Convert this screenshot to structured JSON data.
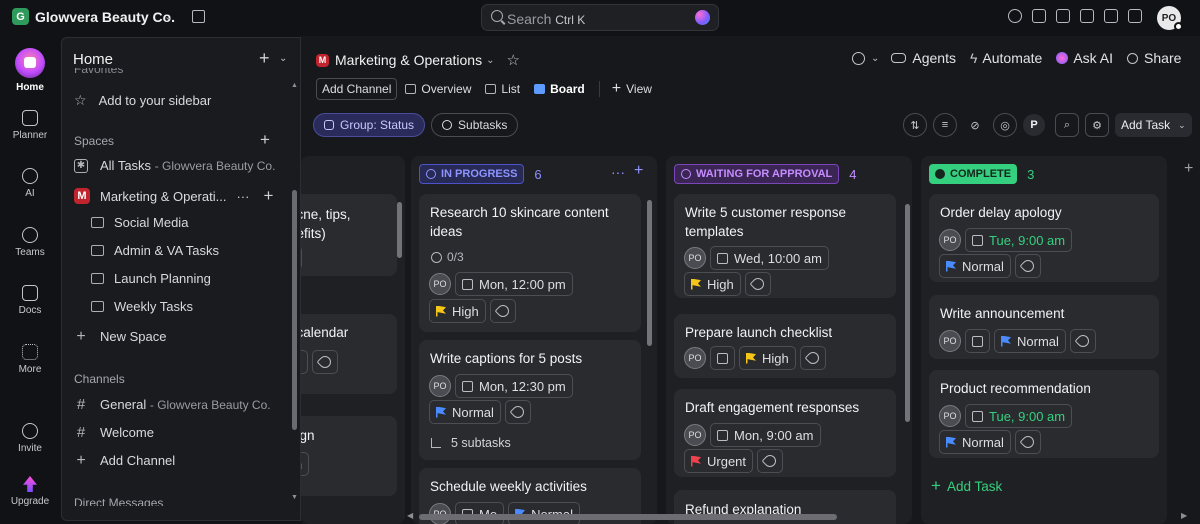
{
  "workspace": {
    "badge": "G",
    "name": "Glowvera Beauty Co."
  },
  "search": {
    "placeholder": "Search",
    "shortcut": "Ctrl K"
  },
  "user": {
    "initials": "PO"
  },
  "rail": [
    {
      "label": "Home",
      "icon": "home-icon"
    },
    {
      "label": "Planner",
      "icon": "planner-icon"
    },
    {
      "label": "AI",
      "icon": "ai-icon"
    },
    {
      "label": "Teams",
      "icon": "teams-icon"
    },
    {
      "label": "Docs",
      "icon": "docs-icon"
    },
    {
      "label": "More",
      "icon": "more-grid-icon"
    },
    {
      "label": "Invite",
      "icon": "invite-icon"
    },
    {
      "label": "Upgrade",
      "icon": "upgrade-icon"
    }
  ],
  "sidebar": {
    "title": "Home",
    "favorites_cut": "Favorites",
    "add_to_sidebar": "Add to your sidebar",
    "spaces_header": "Spaces",
    "all_tasks": "All Tasks",
    "all_tasks_sub": "- Glowvera Beauty Co.",
    "space_badge": "M",
    "space_name": "Marketing & Operati...",
    "folders": [
      "Social Media",
      "Admin & VA Tasks",
      "Launch Planning",
      "Weekly Tasks"
    ],
    "new_space": "New Space",
    "channels_header": "Channels",
    "channel_general": "General",
    "channel_general_sub": "- Glowvera Beauty Co.",
    "channel_welcome": "Welcome",
    "add_channel": "Add Channel",
    "dm_header": "Direct Messages"
  },
  "main": {
    "badge": "M",
    "title": "Marketing & Operations",
    "header_actions": {
      "agents": "Agents",
      "automate": "Automate",
      "ask_ai": "Ask AI",
      "share": "Share"
    },
    "views": {
      "add_channel": "Add Channel",
      "overview": "Overview",
      "list": "List",
      "board": "Board",
      "add_view": "View"
    },
    "filters": {
      "group": "Group: Status",
      "subtasks": "Subtasks"
    },
    "tools": {
      "p_badge": "P",
      "add_task": "Add Task"
    }
  },
  "partial_col": {
    "texts": [
      "acne, tips,",
      "nefits)",
      "m",
      "t calendar",
      "ow",
      "aign",
      "am"
    ]
  },
  "columns": [
    {
      "status": "IN PROGRESS",
      "count": "6",
      "color": "#6b70ff",
      "cards": [
        {
          "title": "Research 10 skincare content ideas",
          "checklist": "0/3",
          "assignee": "PO",
          "date": "Mon, 12:00 pm",
          "priority": "High"
        },
        {
          "title": "Write captions for 5 posts",
          "assignee": "PO",
          "date": "Mon, 12:30 pm",
          "priority": "Normal",
          "subtasks": "5 subtasks"
        },
        {
          "title": "Schedule weekly activities",
          "assignee": "PO",
          "date": "Mo",
          "priority": "Normal"
        }
      ]
    },
    {
      "status": "WAITING FOR APPROVAL",
      "count": "4",
      "color": "#b061ff",
      "cards": [
        {
          "title": "Write 5 customer response templates",
          "assignee": "PO",
          "date": "Wed, 10:00 am",
          "priority": "High"
        },
        {
          "title": "Prepare launch checklist",
          "assignee": "PO",
          "priority": "High"
        },
        {
          "title": "Draft engagement responses",
          "assignee": "PO",
          "date": "Mon, 9:00 am",
          "priority": "Urgent"
        },
        {
          "title": "Refund explanation"
        }
      ]
    },
    {
      "status": "COMPLETE",
      "count": "3",
      "color": "#35d07f",
      "cards": [
        {
          "title": "Order delay apology",
          "assignee": "PO",
          "date": "Tue, 9:00 am",
          "priority": "Normal"
        },
        {
          "title": "Write announcement",
          "assignee": "PO",
          "priority": "Normal"
        },
        {
          "title": "Product recommendation",
          "assignee": "PO",
          "date": "Tue, 9:00 am",
          "priority": "Normal"
        }
      ],
      "add_task": "Add Task"
    }
  ]
}
